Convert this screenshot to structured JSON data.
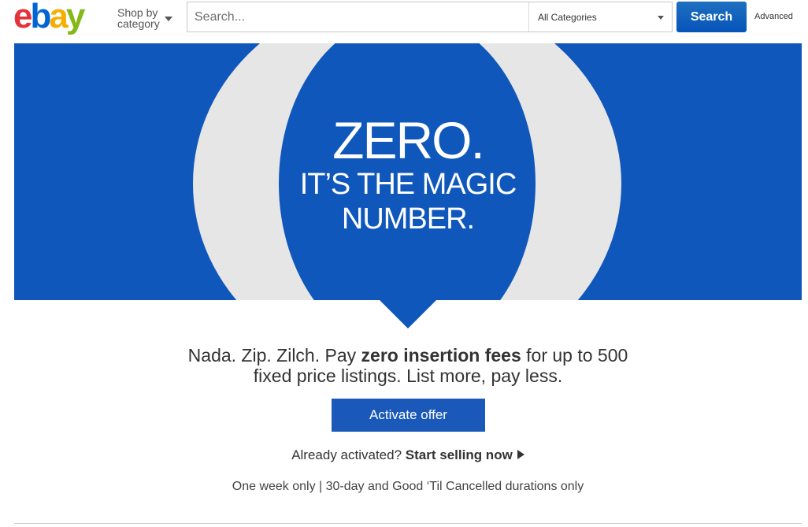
{
  "header": {
    "logo": {
      "letters": [
        "e",
        "b",
        "a",
        "y"
      ],
      "colors": [
        "#e53238",
        "#0064d2",
        "#f5af02",
        "#86b817"
      ]
    },
    "shop_by_category": "Shop by category",
    "search": {
      "placeholder": "Search...",
      "value": ""
    },
    "category_select": {
      "selected": "All Categories"
    },
    "search_button": "Search",
    "advanced_link": "Advanced"
  },
  "hero": {
    "line1": "ZERO.",
    "line2": "IT’S THE MAGIC",
    "line3": "NUMBER.",
    "colors": {
      "blue": "#0f57bb",
      "ring": "#e6e6e6"
    }
  },
  "offer": {
    "prefix": "Nada. Zip. Zilch. Pay ",
    "emphasis": "zero insertion fees",
    "suffix_line1": " for up to 500",
    "line2": "fixed price listings. List more, pay less."
  },
  "activate_button": "Activate offer",
  "already": {
    "prompt": "Already activated? ",
    "link": "Start selling now"
  },
  "terms": "One week only | 30-day and Good ‘Til Cancelled durations only",
  "icons": {
    "shop_by_caret": "chevron-down-icon",
    "category_caret": "chevron-down-icon",
    "start_selling_arrow": "play-arrow-icon"
  }
}
